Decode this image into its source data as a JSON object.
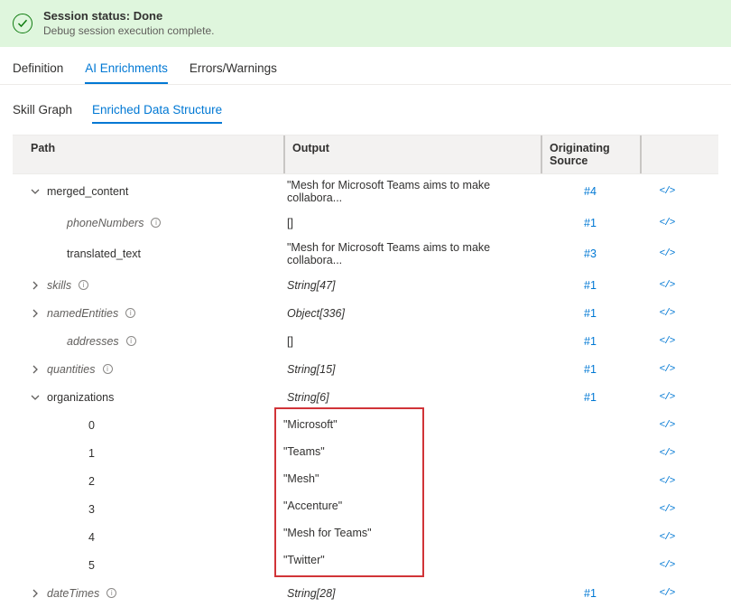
{
  "status": {
    "title": "Session status: Done",
    "subtitle": "Debug session execution complete."
  },
  "mainTabs": [
    "Definition",
    "AI Enrichments",
    "Errors/Warnings"
  ],
  "subTabs": [
    "Skill Graph",
    "Enriched Data Structure"
  ],
  "columns": {
    "path": "Path",
    "output": "Output",
    "source": "Originating Source"
  },
  "rows": {
    "merged_content": {
      "name": "merged_content",
      "output": "\"Mesh for Microsoft Teams aims to make collabora...",
      "source": "#4"
    },
    "phoneNumbers": {
      "name": "phoneNumbers",
      "output": "[]",
      "source": "#1"
    },
    "translated_text": {
      "name": "translated_text",
      "output": "\"Mesh for Microsoft Teams aims to make collabora...",
      "source": "#3"
    },
    "skills": {
      "name": "skills",
      "output": "String[47]",
      "source": "#1"
    },
    "namedEntities": {
      "name": "namedEntities",
      "output": "Object[336]",
      "source": "#1"
    },
    "addresses": {
      "name": "addresses",
      "output": "[]",
      "source": "#1"
    },
    "quantities": {
      "name": "quantities",
      "output": "String[15]",
      "source": "#1"
    },
    "organizations": {
      "name": "organizations",
      "output": "String[6]",
      "source": "#1"
    },
    "dateTimes": {
      "name": "dateTimes",
      "output": "String[28]",
      "source": "#1"
    }
  },
  "orgItems": [
    {
      "idx": "0",
      "val": "\"Microsoft\""
    },
    {
      "idx": "1",
      "val": "\"Teams\""
    },
    {
      "idx": "2",
      "val": "\"Mesh\""
    },
    {
      "idx": "3",
      "val": "\"Accenture\""
    },
    {
      "idx": "4",
      "val": "\"Mesh for Teams\""
    },
    {
      "idx": "5",
      "val": "\"Twitter\""
    }
  ],
  "code_symbol": "</>"
}
